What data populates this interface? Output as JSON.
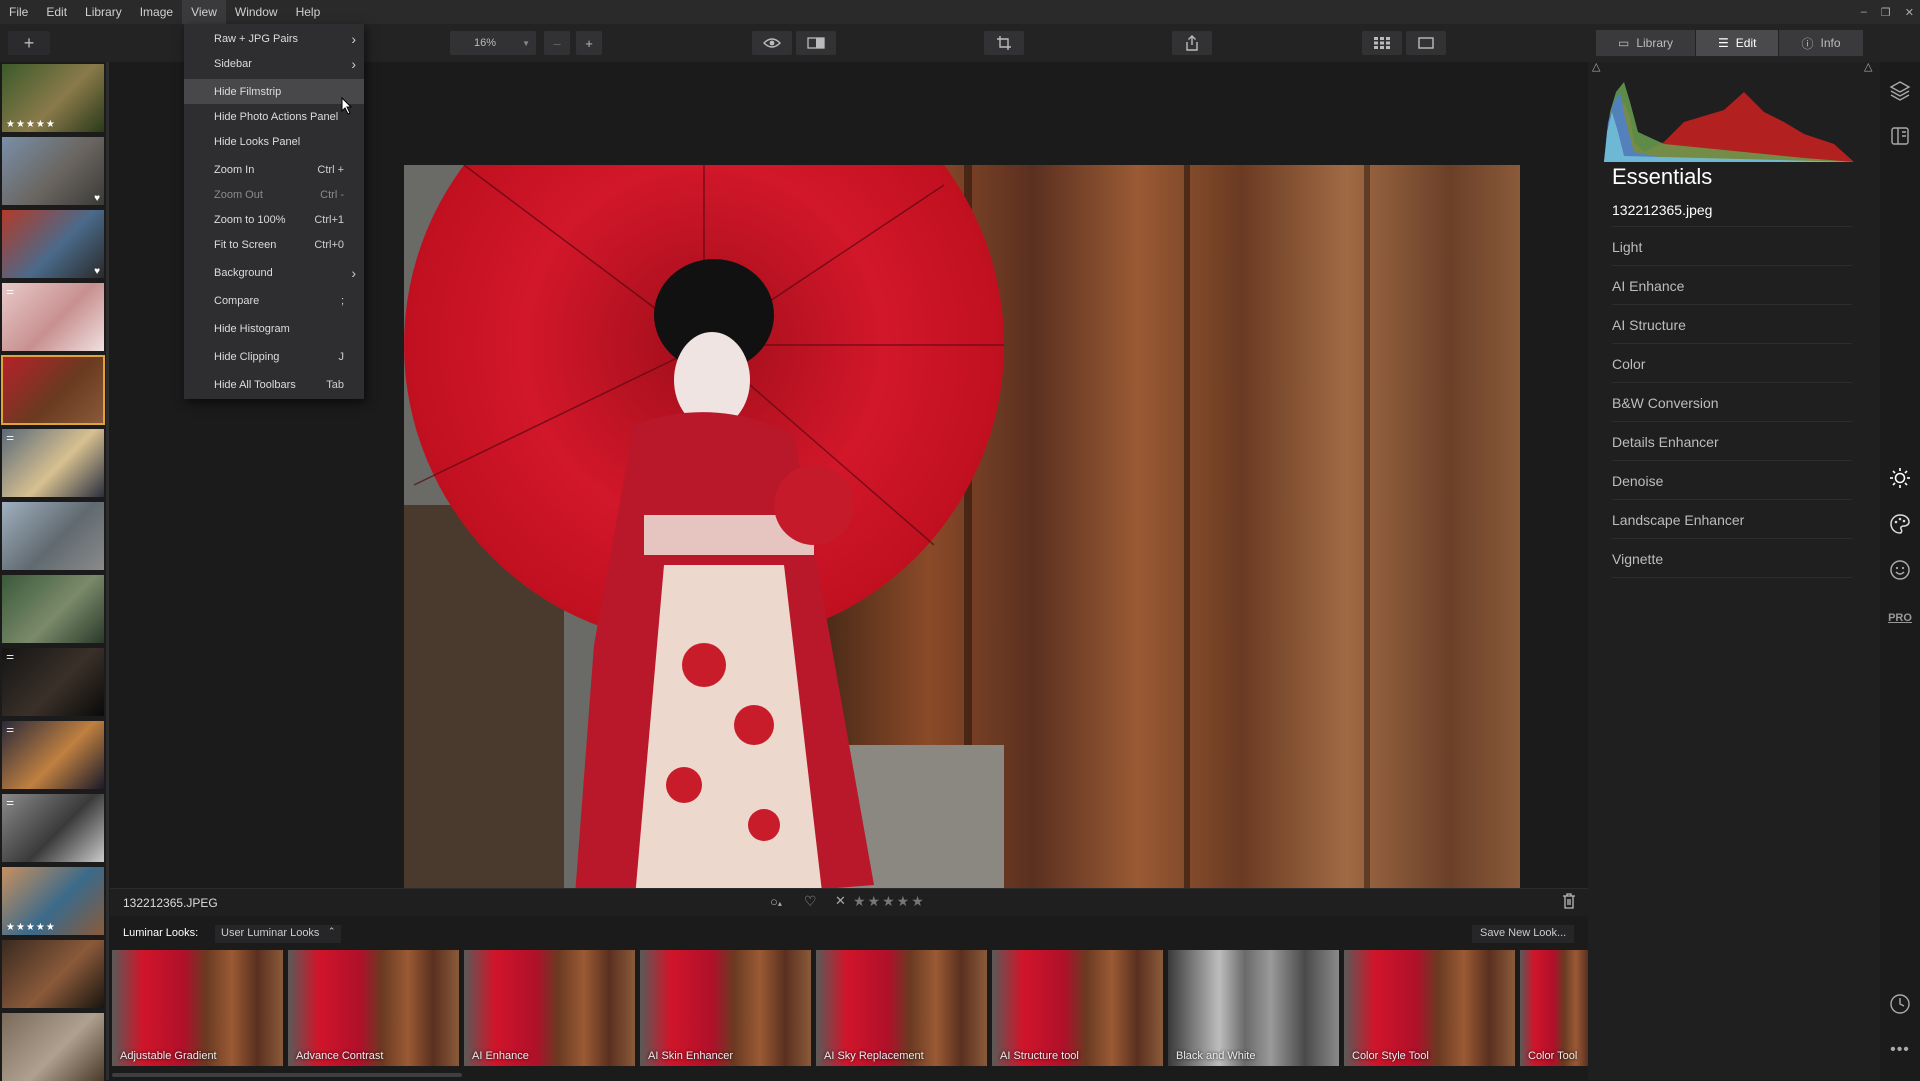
{
  "menubar": {
    "items": [
      "File",
      "Edit",
      "Library",
      "Image",
      "View",
      "Window",
      "Help"
    ],
    "active": "View"
  },
  "window_controls": [
    "–",
    "❐",
    "✕"
  ],
  "toolbar": {
    "add_label": "+",
    "zoom_value": "16%",
    "zoom_minus": "–",
    "zoom_plus": "+",
    "tabs": [
      {
        "label": "Library",
        "icon": "library-icon"
      },
      {
        "label": "Edit",
        "icon": "sliders-icon"
      },
      {
        "label": "Info",
        "icon": "info-icon"
      }
    ],
    "selected_tab": "Edit"
  },
  "view_menu": {
    "items": [
      {
        "label": "Raw + JPG Pairs",
        "shortcut": "",
        "submenu": true
      },
      {
        "label": "Sidebar",
        "shortcut": "",
        "submenu": true
      },
      {
        "label": "Hide Filmstrip",
        "shortcut": "",
        "highlighted": true
      },
      {
        "label": "Hide Photo Actions Panel",
        "shortcut": ""
      },
      {
        "label": "Hide Looks Panel",
        "shortcut": ""
      },
      {
        "label": "Zoom In",
        "shortcut": "Ctrl +"
      },
      {
        "label": "Zoom Out",
        "shortcut": "Ctrl -",
        "disabled": true
      },
      {
        "label": "Zoom to 100%",
        "shortcut": "Ctrl+1"
      },
      {
        "label": "Fit to Screen",
        "shortcut": "Ctrl+0"
      },
      {
        "label": "Background",
        "shortcut": "",
        "submenu": true
      },
      {
        "label": "Compare",
        "shortcut": ";"
      },
      {
        "label": "Hide Histogram",
        "shortcut": ""
      },
      {
        "label": "Hide Clipping",
        "shortcut": "J"
      },
      {
        "label": "Hide All Toolbars",
        "shortcut": "Tab"
      }
    ]
  },
  "filmstrip": {
    "thumbs": [
      {
        "colors": [
          "#3c5a2a",
          "#8a7a4a",
          "#2a3a1a"
        ],
        "stars": "★★★★★"
      },
      {
        "colors": [
          "#7a8fa8",
          "#6a6560",
          "#3a3a38"
        ],
        "heart": true
      },
      {
        "colors": [
          "#b23a2a",
          "#4a6a8a",
          "#2a2a2a"
        ],
        "heart": true
      },
      {
        "colors": [
          "#e8c8c8",
          "#c89090",
          "#f0e0e0"
        ],
        "adjusted": true
      },
      {
        "colors": [
          "#b8202a",
          "#6a3a20",
          "#8a5a3a"
        ],
        "selected": true
      },
      {
        "colors": [
          "#5a6a7a",
          "#d8c090",
          "#2a3040"
        ],
        "adjusted": true
      },
      {
        "colors": [
          "#a0b0c0",
          "#606a70",
          "#8a8a8a"
        ]
      },
      {
        "colors": [
          "#3a5a3a",
          "#7a8a6a",
          "#2a3a2a"
        ]
      },
      {
        "colors": [
          "#151515",
          "#3a3028",
          "#0a0a0a"
        ],
        "adjusted": true
      },
      {
        "colors": [
          "#2a2a3a",
          "#c08040",
          "#1a1a2a"
        ],
        "adjusted": true
      },
      {
        "colors": [
          "#8a8a8a",
          "#3a3a3a",
          "#cacaca"
        ],
        "adjusted": true
      },
      {
        "colors": [
          "#c89060",
          "#3a6a8a",
          "#8a5a3a"
        ],
        "stars": "★★★★★"
      },
      {
        "colors": [
          "#3a2a20",
          "#8a5a3a",
          "#1a1410"
        ]
      },
      {
        "colors": [
          "#7a6a5a",
          "#b0a090",
          "#4a3a2a"
        ]
      }
    ]
  },
  "photo_info": {
    "filename": "132212365.JPEG",
    "flag_icon": "circle-flag-icon",
    "rating": "★★★★★"
  },
  "looks": {
    "label": "Luminar Looks:",
    "collection": "User Luminar Looks",
    "save_label": "Save New Look...",
    "items": [
      {
        "name": "Adjustable Gradient",
        "bw": false
      },
      {
        "name": "Advance Contrast",
        "bw": false
      },
      {
        "name": "AI Enhance",
        "bw": false
      },
      {
        "name": "AI Skin Enhancer",
        "bw": false
      },
      {
        "name": "AI Sky Replacement",
        "bw": false
      },
      {
        "name": "AI Structure tool",
        "bw": false
      },
      {
        "name": "Black and White",
        "bw": true
      },
      {
        "name": "Color Style Tool",
        "bw": false
      },
      {
        "name": "Color Tool",
        "bw": false
      }
    ]
  },
  "right_panel": {
    "title": "Essentials",
    "filename": "132212365.jpeg",
    "tools": [
      "Light",
      "AI Enhance",
      "AI Structure",
      "Color",
      "B&W Conversion",
      "Details Enhancer",
      "Denoise",
      "Landscape Enhancer",
      "Vignette"
    ],
    "side_icons": [
      "layers-icon",
      "canvas-icon",
      "sun-icon",
      "palette-icon",
      "face-icon",
      "pro-icon",
      "history-icon",
      "more-icon"
    ],
    "pro_label": "PRO"
  }
}
